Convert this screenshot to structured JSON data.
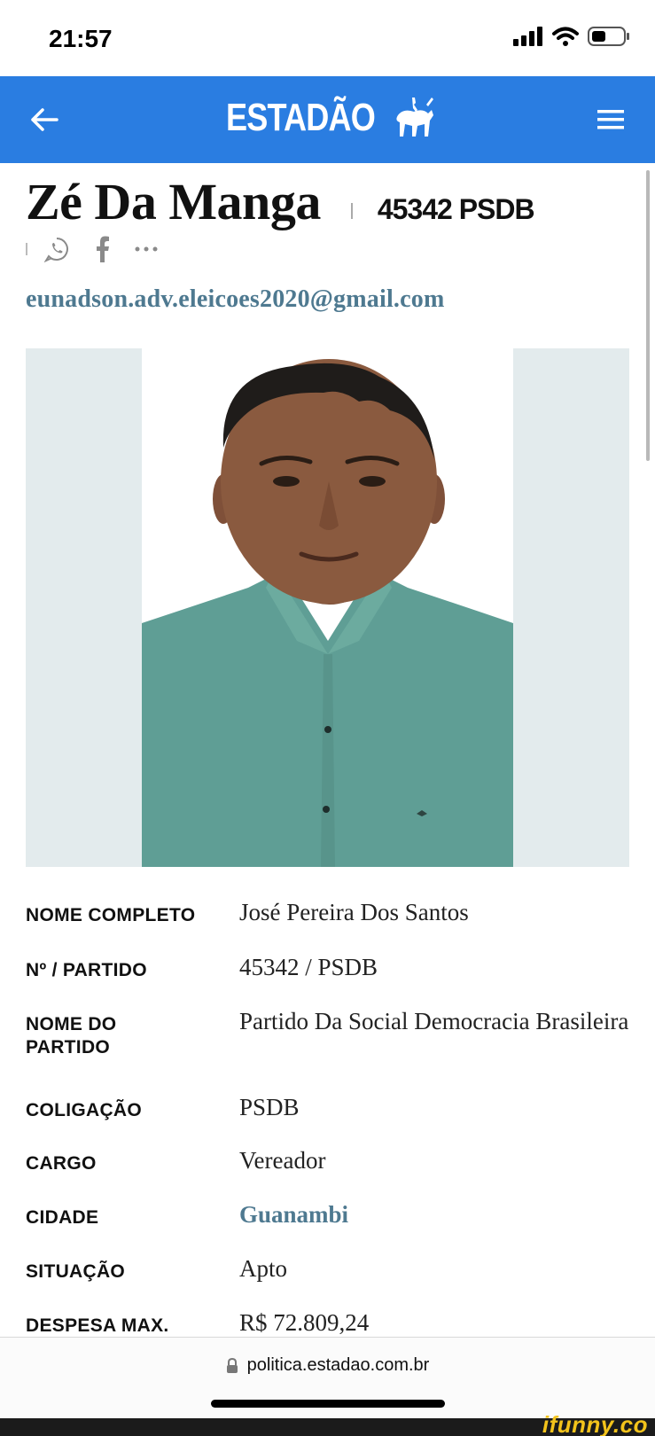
{
  "status_bar": {
    "time": "21:57"
  },
  "header": {
    "logo_text": "ESTADÃO",
    "brand_color": "#2a7de1"
  },
  "candidate": {
    "name": "Zé Da Manga",
    "number_party": "45342 PSDB",
    "email": "eunadson.adv.eleicoes2020@gmail.com"
  },
  "share": {
    "icons": [
      "whatsapp-icon",
      "facebook-icon",
      "more-icon"
    ]
  },
  "info": [
    {
      "label": "NOME COMPLETO",
      "value": "José Pereira Dos Santos"
    },
    {
      "label": "Nº / PARTIDO",
      "value": "45342 / PSDB"
    },
    {
      "label": "NOME DO PARTIDO",
      "value": "Partido Da Social Democracia Brasileira"
    },
    {
      "label": "COLIGAÇÃO",
      "value": "PSDB"
    },
    {
      "label": "CARGO",
      "value": "Vereador"
    },
    {
      "label": "CIDADE",
      "value": "Guanambi"
    },
    {
      "label": "SITUAÇÃO",
      "value": "Apto"
    },
    {
      "label": "DESPESA MAX.",
      "value": "R$ 72.809,24"
    }
  ],
  "browser": {
    "url": "politica.estadao.com.br"
  },
  "watermark": {
    "text": "ifunny.co"
  },
  "colors": {
    "link": "#4e7990",
    "photo_bg": "#e3ebed",
    "shirt": "#5f9e95"
  }
}
